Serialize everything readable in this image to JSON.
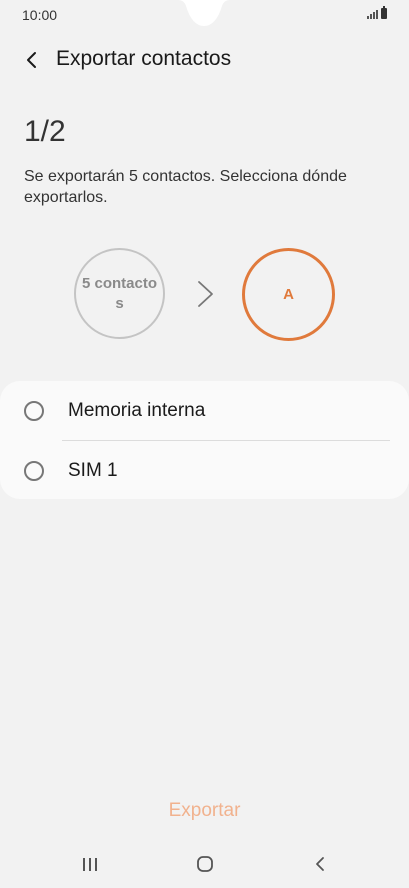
{
  "status_bar": {
    "time": "10:00",
    "icons": [
      "signal-icon",
      "battery-icon"
    ]
  },
  "header": {
    "back_icon": "chevron-left-icon",
    "title": "Exportar contactos"
  },
  "step": "1/2",
  "description": "Se exportarán 5 contactos. Selecciona dónde exportarlos.",
  "diagram": {
    "source_label": "5 contacto\ns",
    "arrow_icon": "chevron-right-icon",
    "target_label": "A"
  },
  "options": [
    {
      "label": "Memoria interna",
      "selected": false
    },
    {
      "label": "SIM 1",
      "selected": false
    }
  ],
  "actions": {
    "export_label": "Exportar"
  },
  "navigation": {
    "recent_icon": "recent-apps-icon",
    "home_icon": "home-icon",
    "back_icon": "back-icon"
  },
  "colors": {
    "accent": "#e07a3c",
    "accent_disabled": "#f1b28e",
    "background": "#f2f2f2",
    "card": "#fafafa"
  }
}
